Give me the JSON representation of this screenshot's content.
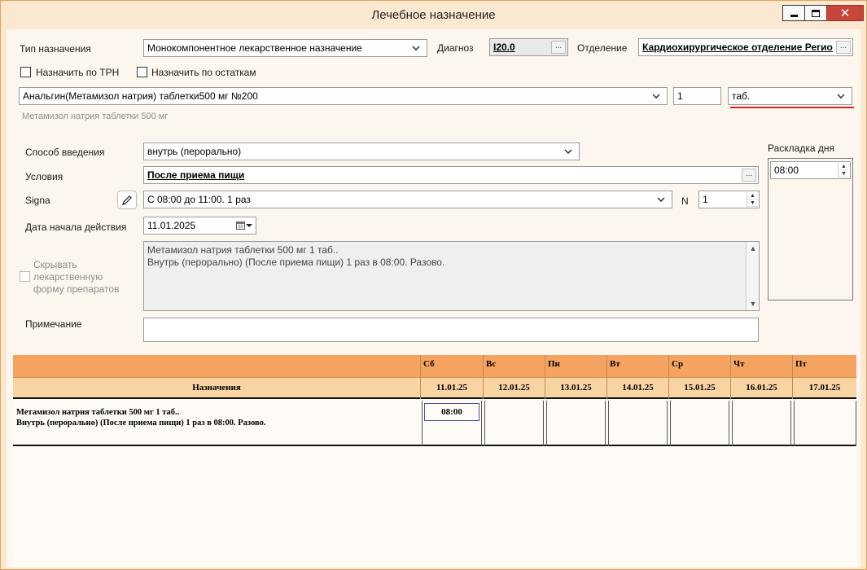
{
  "window": {
    "title": "Лечебное назначение"
  },
  "form": {
    "type_label": "Тип назначения",
    "type_value": "Монокомпонентное лекарственное назначение",
    "diagnosis_label": "Диагноз",
    "diagnosis_value": "I20.0",
    "department_label": "Отделение",
    "department_value": "Кардиохирургическое отделение Регион",
    "assign_trn_label": "Назначить по ТРН",
    "assign_remains_label": "Назначить по остаткам",
    "drug_value": "Анальгин(Метамизол натрия) таблетки500 мг №200",
    "dose_value": "1",
    "unit_value": "таб.",
    "drug_hint": "Метамизол натрия таблетки 500 мг",
    "route_label": "Способ введения",
    "route_value": "внутрь (перорально)",
    "conditions_label": "Условия",
    "conditions_value": "После приема пищи",
    "signa_label": "Signa",
    "signa_value": "С 08:00 до 11:00. 1 раз",
    "n_label": "N",
    "n_value": "1",
    "start_date_label": "Дата начала действия",
    "start_date_value": "11.01.2025",
    "hide_form_label_1": "Скрывать",
    "hide_form_label_2": "лекарственную",
    "hide_form_label_3": "форму препаратов",
    "summary_line_1": "Метамизол натрия таблетки 500 мг 1 таб..",
    "summary_line_2": "Внутрь (перорально) (После приема пищи) 1 раз в 08:00. Разово.",
    "note_label": "Примечание",
    "note_value": "",
    "raskladka_label": "Раскладка дня",
    "raskladka_time": "08:00",
    "ellipsis": "..."
  },
  "grid": {
    "header_label": "Назначения",
    "days": [
      {
        "name": "Сб",
        "date": "11.01.25"
      },
      {
        "name": "Вс",
        "date": "12.01.25"
      },
      {
        "name": "Пн",
        "date": "13.01.25"
      },
      {
        "name": "Вт",
        "date": "14.01.25"
      },
      {
        "name": "Ср",
        "date": "15.01.25"
      },
      {
        "name": "Чт",
        "date": "16.01.25"
      },
      {
        "name": "Пт",
        "date": "17.01.25"
      }
    ],
    "rows": [
      {
        "line_1": "Метамизол натрия таблетки 500 мг 1 таб..",
        "line_2": "Внутрь (перорально) (После приема пищи) 1 раз в 08:00. Разово.",
        "time": "08:00"
      }
    ]
  },
  "icons": {
    "minimize": "minimize-icon",
    "maximize": "maximize-icon",
    "close": "close-icon",
    "dropdown": "chevron-down-icon",
    "pencil": "pencil-icon",
    "calendar": "calendar-icon"
  }
}
